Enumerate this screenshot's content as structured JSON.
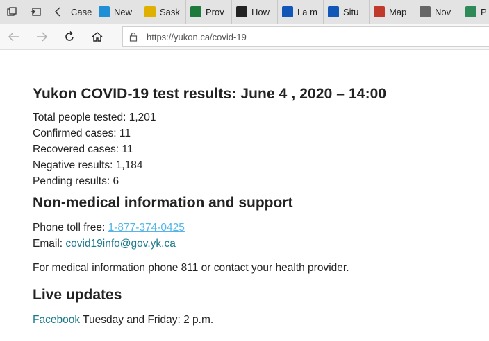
{
  "tabs": [
    {
      "label": "Case",
      "icon": "document-icon",
      "color": "#888888"
    },
    {
      "label": "New",
      "icon": "chart-icon",
      "color": "#1f8fd6"
    },
    {
      "label": "Sask",
      "icon": "saskatchewan-icon",
      "color": "#e0b000"
    },
    {
      "label": "Prov",
      "icon": "province-icon",
      "color": "#1e7a3a"
    },
    {
      "label": "How",
      "icon": "shield-icon",
      "color": "#222222"
    },
    {
      "label": "La m",
      "icon": "quebec-flag-icon",
      "color": "#1256b8"
    },
    {
      "label": "Situ",
      "icon": "quebec-flag-icon",
      "color": "#1256b8"
    },
    {
      "label": "Map",
      "icon": "map-icon",
      "color": "#c0392b"
    },
    {
      "label": "Nov",
      "icon": "image-icon",
      "color": "#666666"
    },
    {
      "label": "P",
      "icon": "tree-icon",
      "color": "#2e8b57"
    }
  ],
  "address": {
    "url": "https://yukon.ca/covid-19"
  },
  "page": {
    "title": "Yukon COVID-19 test results: June 4 , 2020 – 14:00",
    "stats": [
      "Total people tested: 1,201",
      "Confirmed cases: 11",
      "Recovered cases: 11",
      "Negative results: 1,184",
      "Pending results: 6"
    ],
    "support_heading": "Non-medical information and support",
    "phone_label": "Phone toll free: ",
    "phone_number": "1-877-374-0425",
    "email_label": "Email: ",
    "email": "covid19info@gov.yk.ca",
    "medical_note": "For medical information phone 811 or contact your health provider.",
    "live_heading": "Live updates",
    "facebook_link": "Facebook",
    "live_schedule": " Tuesday and Friday: 2 p.m."
  }
}
